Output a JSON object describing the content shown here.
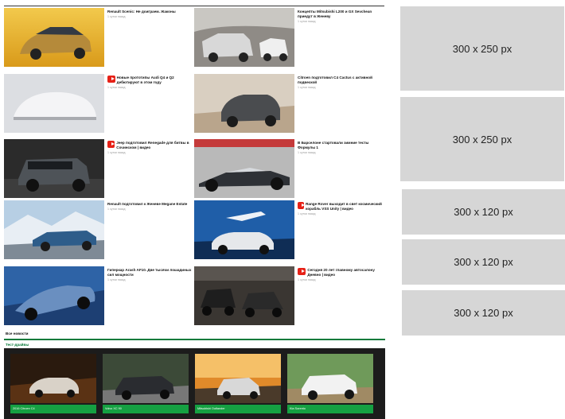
{
  "news": {
    "items": [
      {
        "title": "Renault Scenic: Не доиграем. Жаконы",
        "date": "1 сутки назад",
        "youtube": false
      },
      {
        "title": "Концепты Mitsubishi L200 и GX Sevchean приедут в Женеву",
        "date": "1 сутки назад",
        "youtube": false
      },
      {
        "title": "Новые прототипы Audi Q4 и Q2 дебютируют в этом году",
        "date": "1 сутки назад",
        "youtube": true
      },
      {
        "title": "Citroen подготовил C4 Cactus с активной подвеской",
        "date": "1 сутки назад",
        "youtube": false
      },
      {
        "title": "Jeep подготовил Renegade для битвы в Сочинском | видео",
        "date": "1 сутки назад",
        "youtube": true
      },
      {
        "title": "В Барселоне стартовали зимние тесты Формулы 1",
        "date": "1 сутки назад",
        "youtube": false
      },
      {
        "title": "Renault подготовил к Женеве Megane Estate",
        "date": "1 сутки назад",
        "youtube": false
      },
      {
        "title": "Range Rover выходит в свет космический корабль VSS Unity | видео",
        "date": "1 сутки назад",
        "youtube": true
      },
      {
        "title": "Гиперкар Arash AF10. Две тысячи лошадиных сил мощности",
        "date": "1 сутки назад",
        "youtube": false
      },
      {
        "title": "Сегодня 20 лет главному автосалону Дневно | видео",
        "date": "1 сутки назад",
        "youtube": true
      }
    ],
    "all_news_label": "Все новости"
  },
  "test_drives": {
    "title": "Тест-драйвы",
    "items": [
      {
        "caption": "2016 Citroen C4"
      },
      {
        "caption": "Volvo XC 90"
      },
      {
        "caption": "Mitsubishi Outlander"
      },
      {
        "caption": "Kia Sorento"
      }
    ]
  },
  "ads": [
    {
      "label": "300 x 250 px"
    },
    {
      "label": "300 x 250 px"
    },
    {
      "label": "300 x 120 px"
    },
    {
      "label": "300 x 120 px"
    },
    {
      "label": "300 x 120 px"
    }
  ],
  "colors": {
    "accent_green": "#15a042",
    "youtube_red": "#e62117",
    "ad_gray": "#d6d6d6"
  }
}
